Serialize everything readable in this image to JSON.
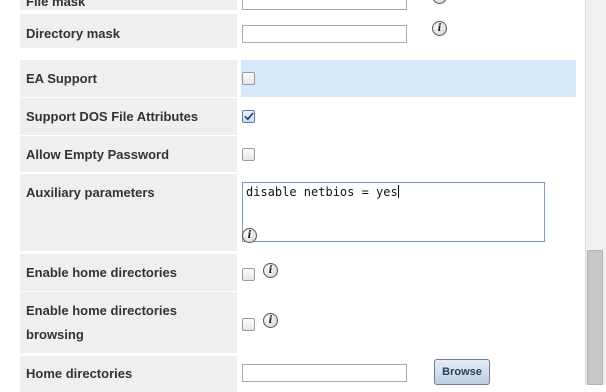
{
  "fields": {
    "file_mask": {
      "label": "File mask",
      "value": ""
    },
    "directory_mask": {
      "label": "Directory mask",
      "value": ""
    },
    "ea_support": {
      "label": "EA Support",
      "checked": false
    },
    "support_dos_attrs": {
      "label": "Support DOS File Attributes",
      "checked": true
    },
    "allow_empty_password": {
      "label": "Allow Empty Password",
      "checked": false
    },
    "auxiliary_parameters": {
      "label": "Auxiliary parameters",
      "value": "disable netbios = yes"
    },
    "enable_home_directories": {
      "label": "Enable home directories",
      "checked": false
    },
    "enable_home_browsing": {
      "label_line1": "Enable home directories",
      "label_line2": "browsing",
      "checked": false
    },
    "home_directories": {
      "label": "Home directories",
      "value": "",
      "browse_label": "Browse"
    }
  },
  "icons": {
    "info": "i"
  },
  "colors": {
    "highlight_row": "#d6e9fb",
    "label_bg": "#efefef"
  }
}
